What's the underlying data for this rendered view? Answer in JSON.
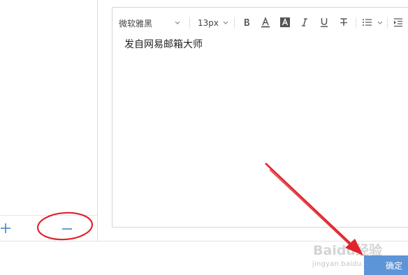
{
  "toolbar": {
    "font_family": "微软雅黑",
    "font_size": "13px"
  },
  "editor": {
    "content": "发自网易邮箱大师"
  },
  "footer": {
    "ok_label": "确定"
  },
  "watermark": {
    "logo_text": "Baidu经验",
    "url": "jingyan.baidu.com"
  },
  "colors": {
    "accent_blue": "#5d95d8",
    "icon_blue": "#3d86c9",
    "annotation_red": "#e0242c"
  },
  "icons": {
    "left_add": "plus-icon",
    "left_remove": "minus-icon",
    "bold": "bold-icon",
    "font_color": "font-color-icon",
    "background_color": "background-color-icon",
    "italic": "italic-icon",
    "underline": "underline-icon",
    "strikethrough": "strikethrough-icon",
    "list": "list-icon",
    "indent": "indent-icon"
  }
}
